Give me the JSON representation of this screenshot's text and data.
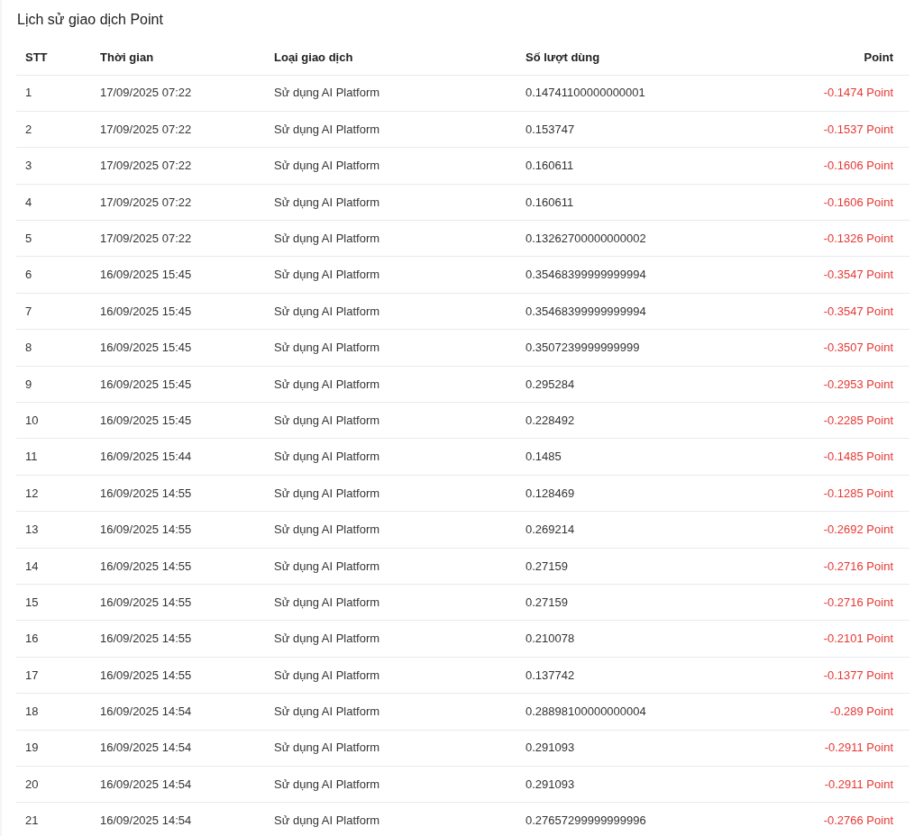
{
  "title": "Lịch sử giao dịch Point",
  "table": {
    "columns": [
      "STT",
      "Thời gian",
      "Loại giao dịch",
      "Số lượt dùng",
      "Point"
    ],
    "rows": [
      {
        "stt": "1",
        "time": "17/09/2025 07:22",
        "type": "Sử dụng AI Platform",
        "usage": "0.14741100000000001",
        "point": "-0.1474 Point"
      },
      {
        "stt": "2",
        "time": "17/09/2025 07:22",
        "type": "Sử dụng AI Platform",
        "usage": "0.153747",
        "point": "-0.1537 Point"
      },
      {
        "stt": "3",
        "time": "17/09/2025 07:22",
        "type": "Sử dụng AI Platform",
        "usage": "0.160611",
        "point": "-0.1606 Point"
      },
      {
        "stt": "4",
        "time": "17/09/2025 07:22",
        "type": "Sử dụng AI Platform",
        "usage": "0.160611",
        "point": "-0.1606 Point"
      },
      {
        "stt": "5",
        "time": "17/09/2025 07:22",
        "type": "Sử dụng AI Platform",
        "usage": "0.13262700000000002",
        "point": "-0.1326 Point"
      },
      {
        "stt": "6",
        "time": "16/09/2025 15:45",
        "type": "Sử dụng AI Platform",
        "usage": "0.35468399999999994",
        "point": "-0.3547 Point"
      },
      {
        "stt": "7",
        "time": "16/09/2025 15:45",
        "type": "Sử dụng AI Platform",
        "usage": "0.35468399999999994",
        "point": "-0.3547 Point"
      },
      {
        "stt": "8",
        "time": "16/09/2025 15:45",
        "type": "Sử dụng AI Platform",
        "usage": "0.3507239999999999",
        "point": "-0.3507 Point"
      },
      {
        "stt": "9",
        "time": "16/09/2025 15:45",
        "type": "Sử dụng AI Platform",
        "usage": "0.295284",
        "point": "-0.2953 Point"
      },
      {
        "stt": "10",
        "time": "16/09/2025 15:45",
        "type": "Sử dụng AI Platform",
        "usage": "0.228492",
        "point": "-0.2285 Point"
      },
      {
        "stt": "11",
        "time": "16/09/2025 15:44",
        "type": "Sử dụng AI Platform",
        "usage": "0.1485",
        "point": "-0.1485 Point"
      },
      {
        "stt": "12",
        "time": "16/09/2025 14:55",
        "type": "Sử dụng AI Platform",
        "usage": "0.128469",
        "point": "-0.1285 Point"
      },
      {
        "stt": "13",
        "time": "16/09/2025 14:55",
        "type": "Sử dụng AI Platform",
        "usage": "0.269214",
        "point": "-0.2692 Point"
      },
      {
        "stt": "14",
        "time": "16/09/2025 14:55",
        "type": "Sử dụng AI Platform",
        "usage": "0.27159",
        "point": "-0.2716 Point"
      },
      {
        "stt": "15",
        "time": "16/09/2025 14:55",
        "type": "Sử dụng AI Platform",
        "usage": "0.27159",
        "point": "-0.2716 Point"
      },
      {
        "stt": "16",
        "time": "16/09/2025 14:55",
        "type": "Sử dụng AI Platform",
        "usage": "0.210078",
        "point": "-0.2101 Point"
      },
      {
        "stt": "17",
        "time": "16/09/2025 14:55",
        "type": "Sử dụng AI Platform",
        "usage": "0.137742",
        "point": "-0.1377 Point"
      },
      {
        "stt": "18",
        "time": "16/09/2025 14:54",
        "type": "Sử dụng AI Platform",
        "usage": "0.28898100000000004",
        "point": "-0.289 Point"
      },
      {
        "stt": "19",
        "time": "16/09/2025 14:54",
        "type": "Sử dụng AI Platform",
        "usage": "0.291093",
        "point": "-0.2911 Point"
      },
      {
        "stt": "20",
        "time": "16/09/2025 14:54",
        "type": "Sử dụng AI Platform",
        "usage": "0.291093",
        "point": "-0.2911 Point"
      },
      {
        "stt": "21",
        "time": "16/09/2025 14:54",
        "type": "Sử dụng AI Platform",
        "usage": "0.27657299999999996",
        "point": "-0.2766 Point"
      }
    ]
  }
}
